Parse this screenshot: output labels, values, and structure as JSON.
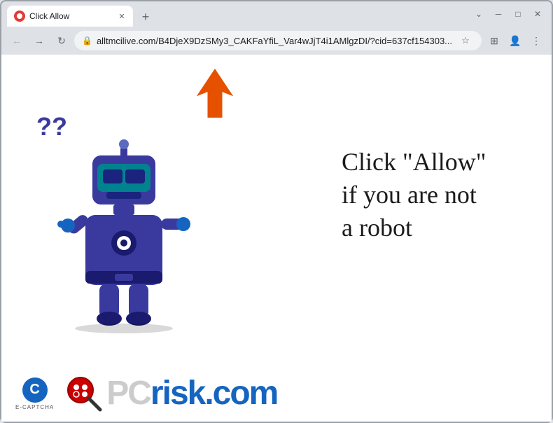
{
  "browser": {
    "tab": {
      "title": "Click Allow",
      "favicon_color": "#e53935"
    },
    "window_controls": {
      "minimize": "─",
      "maximize": "□",
      "close": "✕",
      "chevron_down": "⌄",
      "chevron_up": "⌃"
    },
    "new_tab_label": "+",
    "nav": {
      "back": "←",
      "forward": "→",
      "reload": "↻",
      "url": "alltmcilive.com/B4DjeX9DzSMy3_CAKFaYfiL_Var4wJjT4i1AMlgzDI/?cid=637cf154303...",
      "bookmark": "☆",
      "profile": "👤",
      "menu": "⋮",
      "extensions": "⊞"
    }
  },
  "page": {
    "arrow_color": "#e65100",
    "question_marks": "??",
    "message_line1": "Click \"Allow\"",
    "message_line2": "if you are not",
    "message_line3": "a robot",
    "ecaptcha_label": "E-CAPTCHA",
    "pcrisk_text": "PC",
    "pcrisk_suffix": "risk.com"
  }
}
